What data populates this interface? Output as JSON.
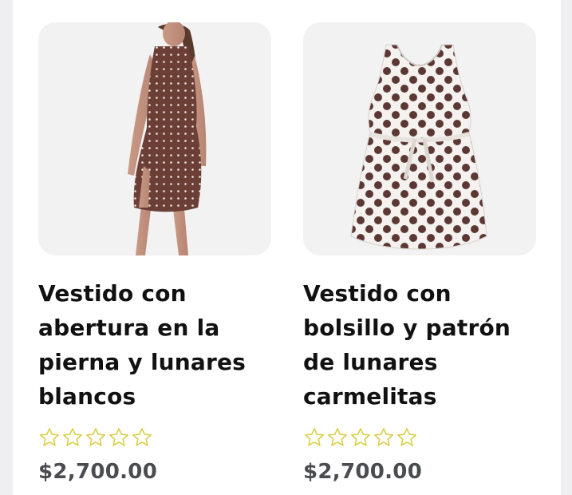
{
  "products": [
    {
      "title": "Vestido con abertura en la pierna y lunares blancos",
      "title_lines": [
        "Vestido con",
        "abertura en la",
        "pierna y lunares",
        "blancos"
      ],
      "rating": 0,
      "rating_max": 5,
      "price": "$2,700.00",
      "image": "model-wearing-brown-polka-dot-dress"
    },
    {
      "title": "Vestido con bolsillo y patrón de lunares carmelitas",
      "title_lines": [
        "Vestido con",
        "bolsillo y patrón",
        "de lunares",
        "carmelitas"
      ],
      "rating": 0,
      "rating_max": 5,
      "price": "$2,700.00",
      "image": "white-dress-brown-polka-dots"
    }
  ],
  "colors": {
    "star_outline": "#d9cf48",
    "price": "#4a4c50",
    "title": "#111111"
  }
}
